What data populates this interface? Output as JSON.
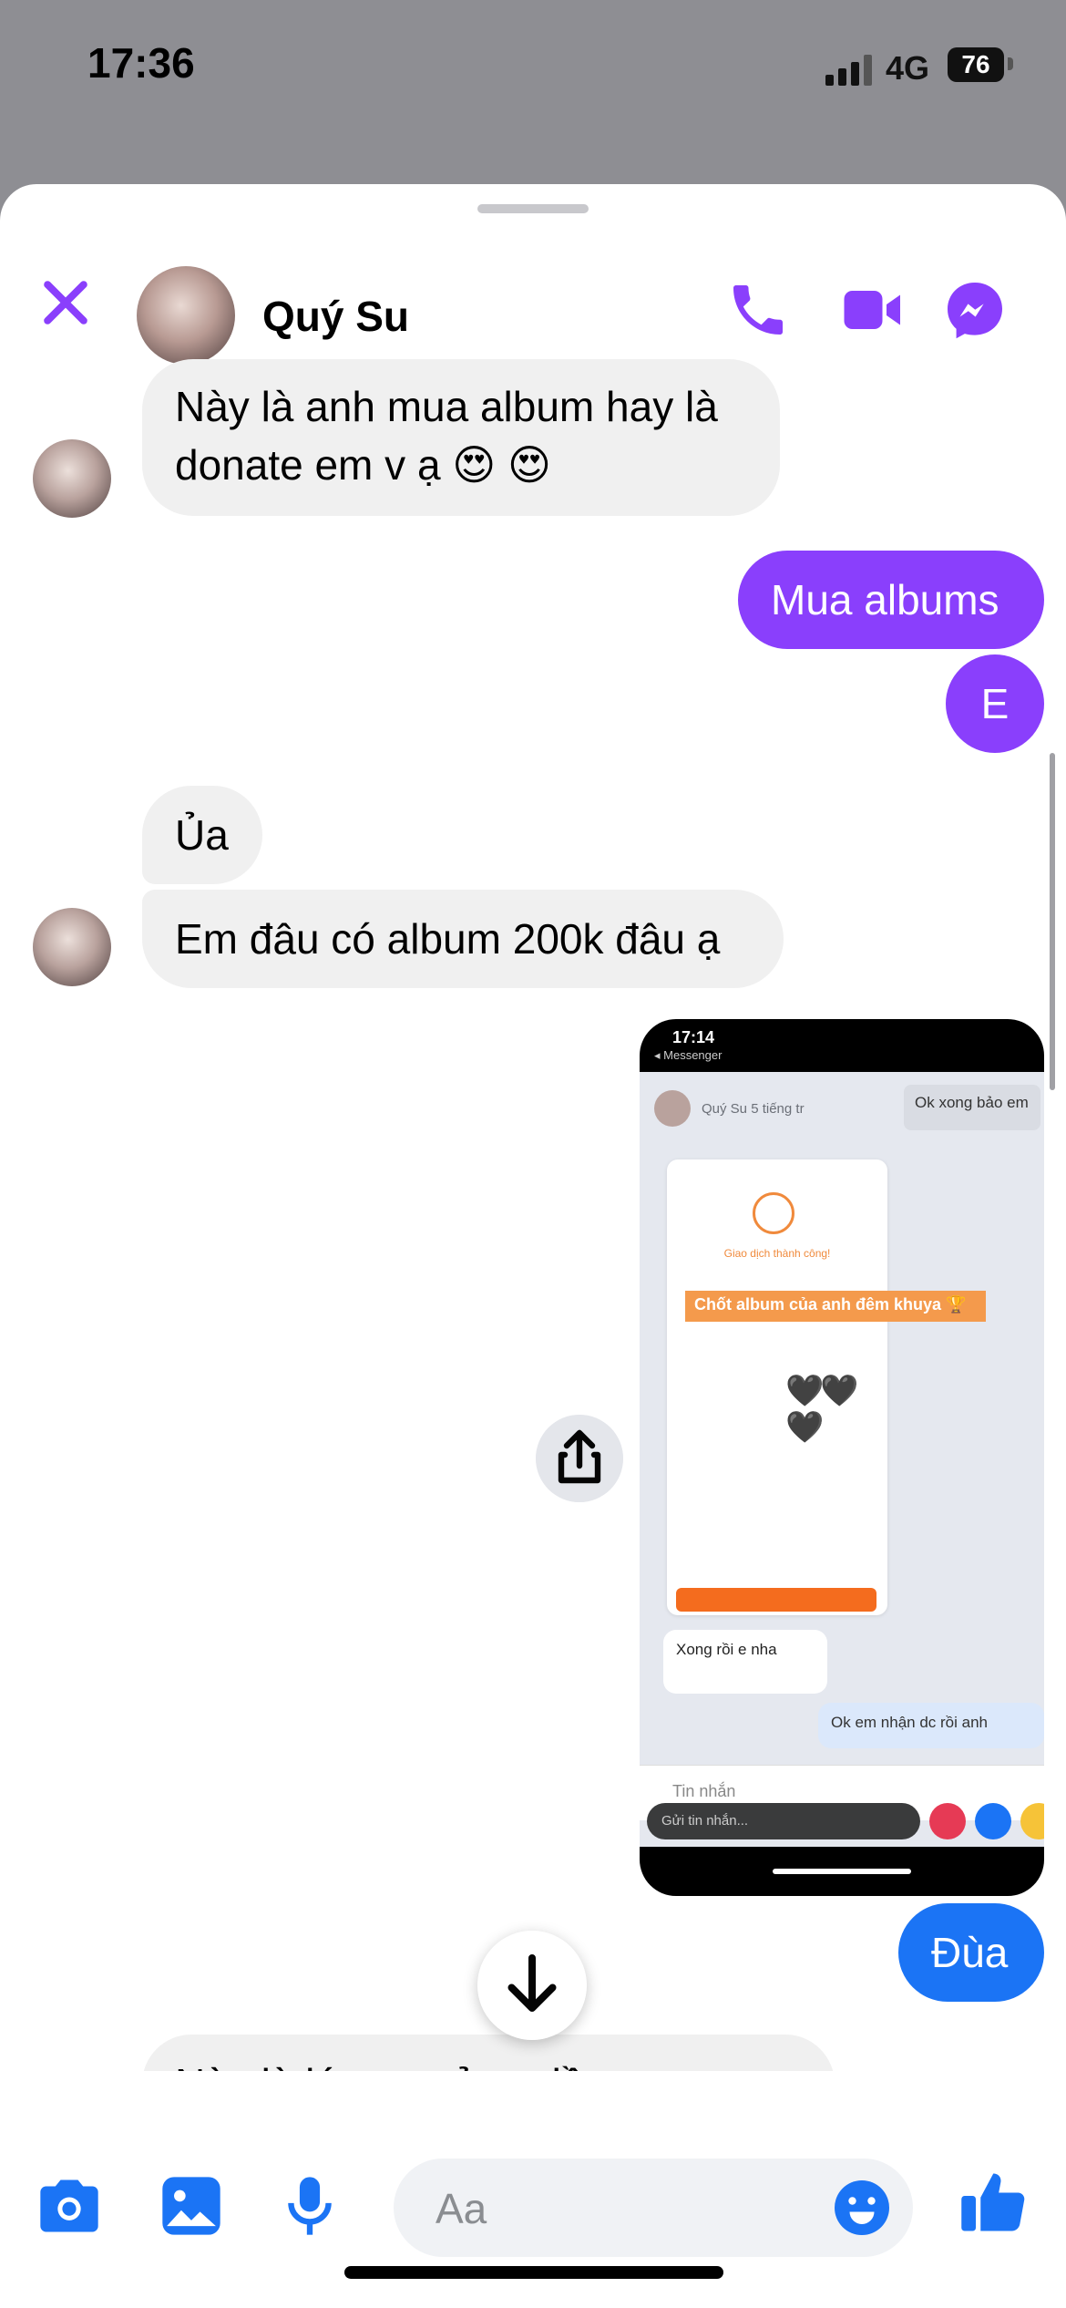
{
  "status_bar": {
    "time": "17:36",
    "network": "4G",
    "battery": "76"
  },
  "header": {
    "contact_name": "Quý Su"
  },
  "messages": [
    {
      "id": "m1",
      "direction": "incoming",
      "lines": [
        "Này là anh mua album hay là",
        "donate em v ạ 😍 😍"
      ]
    },
    {
      "id": "m2",
      "direction": "outgoing",
      "text": "Mua albums"
    },
    {
      "id": "m3",
      "direction": "outgoing",
      "text": "E"
    },
    {
      "id": "m4",
      "direction": "incoming",
      "text": "Ủa"
    },
    {
      "id": "m5",
      "direction": "incoming",
      "text": "Em đâu có album 200k đâu ạ"
    },
    {
      "id": "m6",
      "direction": "outgoing",
      "type": "image"
    },
    {
      "id": "m7",
      "direction": "outgoing",
      "text": "Đùa"
    },
    {
      "id": "m8",
      "direction": "incoming",
      "text": "Này là lúc ... mở ... đầu ..."
    }
  ],
  "shared_screenshot": {
    "time": "17:14",
    "app": "◂ Messenger",
    "story_title": "Quý Su 5 tiếng tr",
    "reply_label": "Ok xong bảo em",
    "order_banner": "Chốt album của anh đêm khuya 🏆",
    "success_text": "Giao dịch thành công!",
    "hearts": "🖤🖤🖤",
    "msg_in": "Xong rồi e nha",
    "msg_out": "Ok em nhận dc rồi anh",
    "input_placeholder": "Tin nhắn",
    "send_placeholder": "Gửi tin nhắn..."
  },
  "composer": {
    "placeholder": "Aa"
  },
  "colors": {
    "accent_purple": "#8a3ffc",
    "accent_blue": "#1b74f5",
    "bubble_gray": "#f0f0f0"
  }
}
